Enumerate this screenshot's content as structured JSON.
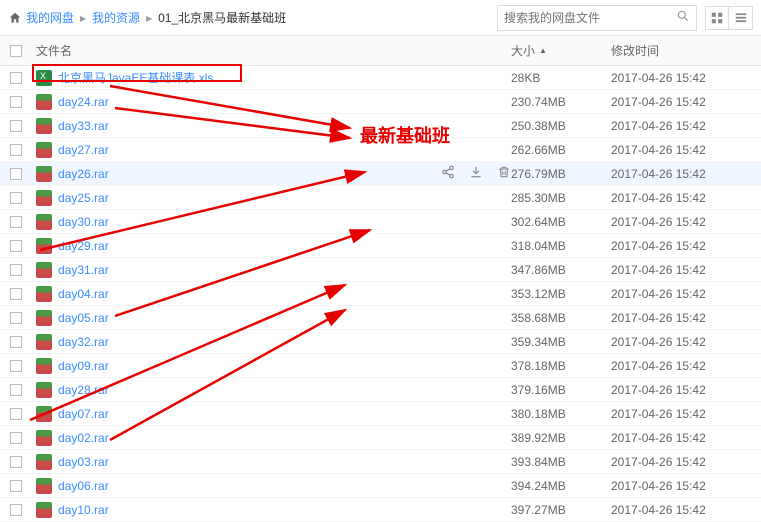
{
  "breadcrumbs": [
    {
      "label": "我的网盘"
    },
    {
      "label": "我的资源"
    },
    {
      "label": "01_北京黑马最新基础班"
    }
  ],
  "search": {
    "placeholder": "搜索我的网盘文件"
  },
  "columns": {
    "name": "文件名",
    "size": "大小",
    "time": "修改时间"
  },
  "annotation": {
    "text": "最新基础班"
  },
  "hovered_index": 4,
  "files": [
    {
      "name": "北京黑马JavaEE基础课表.xls",
      "type": "xls",
      "size": "28KB",
      "time": "2017-04-26 15:42"
    },
    {
      "name": "day24.rar",
      "type": "rar",
      "size": "230.74MB",
      "time": "2017-04-26 15:42"
    },
    {
      "name": "day33.rar",
      "type": "rar",
      "size": "250.38MB",
      "time": "2017-04-26 15:42"
    },
    {
      "name": "day27.rar",
      "type": "rar",
      "size": "262.66MB",
      "time": "2017-04-26 15:42"
    },
    {
      "name": "day26.rar",
      "type": "rar",
      "size": "276.79MB",
      "time": "2017-04-26 15:42"
    },
    {
      "name": "day25.rar",
      "type": "rar",
      "size": "285.30MB",
      "time": "2017-04-26 15:42"
    },
    {
      "name": "day30.rar",
      "type": "rar",
      "size": "302.64MB",
      "time": "2017-04-26 15:42"
    },
    {
      "name": "day29.rar",
      "type": "rar",
      "size": "318.04MB",
      "time": "2017-04-26 15:42"
    },
    {
      "name": "day31.rar",
      "type": "rar",
      "size": "347.86MB",
      "time": "2017-04-26 15:42"
    },
    {
      "name": "day04.rar",
      "type": "rar",
      "size": "353.12MB",
      "time": "2017-04-26 15:42"
    },
    {
      "name": "day05.rar",
      "type": "rar",
      "size": "358.68MB",
      "time": "2017-04-26 15:42"
    },
    {
      "name": "day32.rar",
      "type": "rar",
      "size": "359.34MB",
      "time": "2017-04-26 15:42"
    },
    {
      "name": "day09.rar",
      "type": "rar",
      "size": "378.18MB",
      "time": "2017-04-26 15:42"
    },
    {
      "name": "day28.rar",
      "type": "rar",
      "size": "379.16MB",
      "time": "2017-04-26 15:42"
    },
    {
      "name": "day07.rar",
      "type": "rar",
      "size": "380.18MB",
      "time": "2017-04-26 15:42"
    },
    {
      "name": "day02.rar",
      "type": "rar",
      "size": "389.92MB",
      "time": "2017-04-26 15:42"
    },
    {
      "name": "day03.rar",
      "type": "rar",
      "size": "393.84MB",
      "time": "2017-04-26 15:42"
    },
    {
      "name": "day06.rar",
      "type": "rar",
      "size": "394.24MB",
      "time": "2017-04-26 15:42"
    },
    {
      "name": "day10.rar",
      "type": "rar",
      "size": "397.27MB",
      "time": "2017-04-26 15:42"
    }
  ]
}
